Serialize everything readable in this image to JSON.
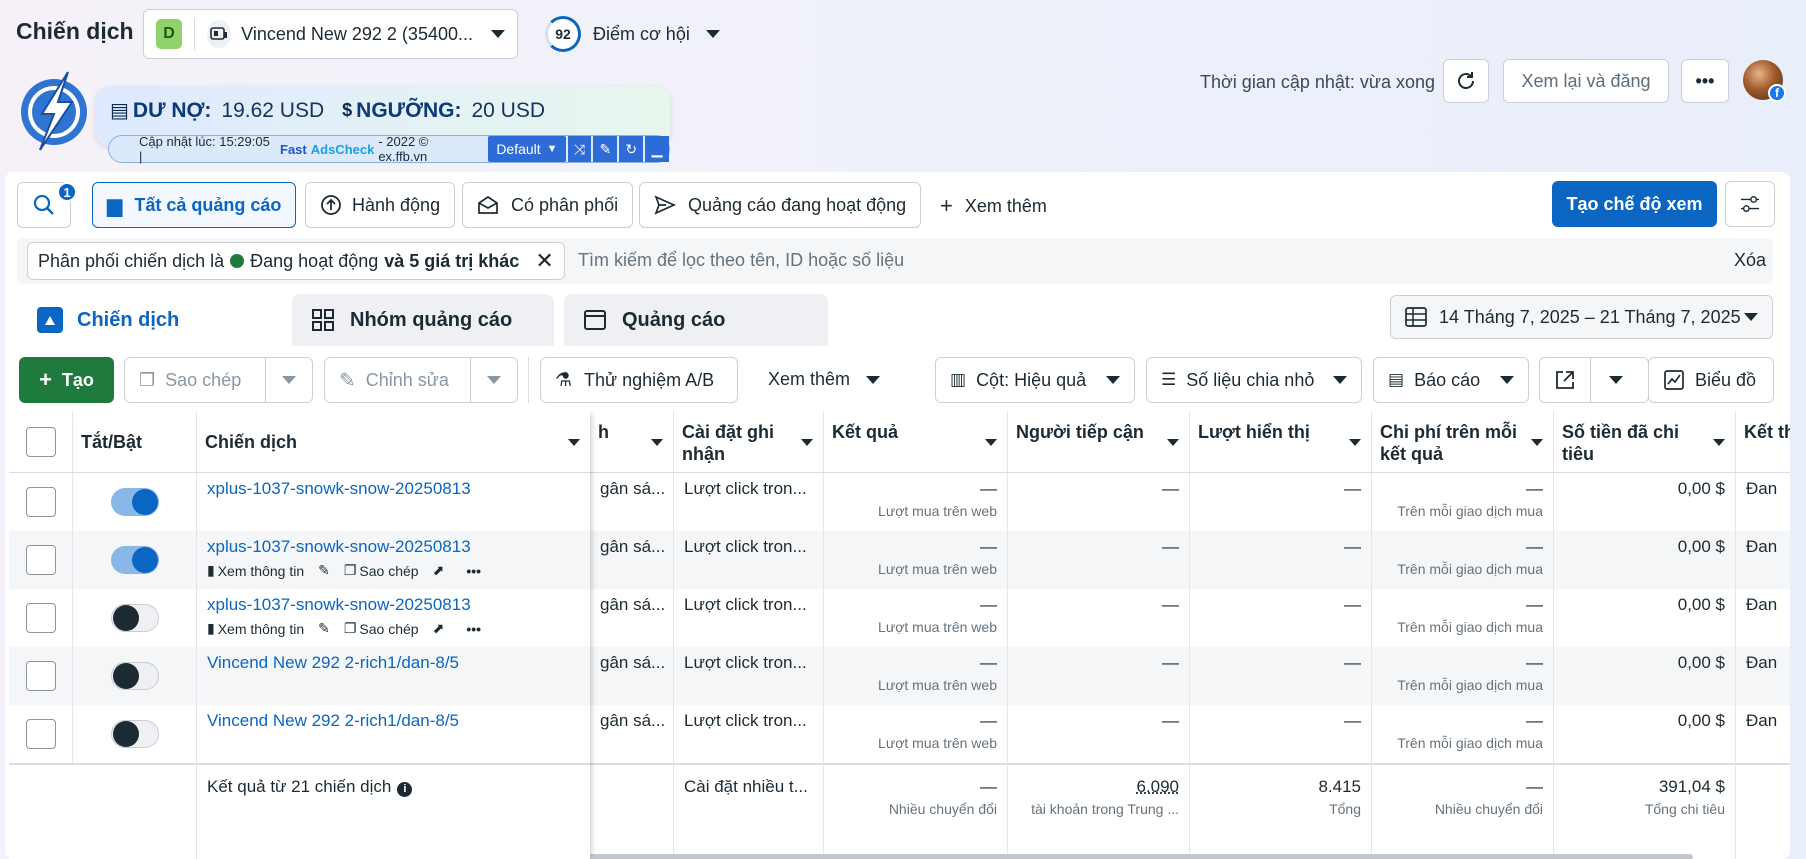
{
  "header": {
    "title": "Chiến dịch",
    "account_badge": "D",
    "account_name": "Vincend New 292 2 (35400...",
    "opportunity_score": "92",
    "opportunity_label": "Điểm cơ hội",
    "update_text": "Thời gian cập nhật: vừa xong",
    "review_button": "Xem lại và đăng",
    "more_button": "•••",
    "avatar_badge": "f"
  },
  "extension": {
    "debt_label": "DƯ NỢ:",
    "debt_value": "19.62 USD",
    "threshold_label": "NGƯỠNG:",
    "threshold_value": "20 USD",
    "status_prefix": "Cập nhật lúc: 15:29:05 |",
    "brand_fast": "Fast",
    "brand_adscheck": "AdsCheck",
    "status_suffix": "- 2022 © ex.ffb.vn",
    "profile_select": "Default"
  },
  "toolbar": {
    "search_badge": "1",
    "all_ads": "Tất cả quảng cáo",
    "actions": "Hành động",
    "delivery": "Có phân phối",
    "active_ads": "Quảng cáo đang hoạt động",
    "see_more": "Xem thêm",
    "create_view": "Tạo chế độ xem"
  },
  "filter": {
    "chip_prefix": "Phân phối chiến dịch là",
    "chip_status": "Đang hoạt động",
    "chip_more": "và 5 giá trị khác",
    "search_placeholder": "Tìm kiếm để lọc theo tên, ID hoặc số liệu",
    "clear": "Xóa"
  },
  "level_tabs": {
    "campaigns": "Chiến dịch",
    "adsets": "Nhóm quảng cáo",
    "ads": "Quảng cáo",
    "date_range": "14 Tháng 7, 2025 – 21 Tháng 7, 2025"
  },
  "actions": {
    "create": "Tạo",
    "duplicate": "Sao chép",
    "edit": "Chỉnh sửa",
    "ab_test": "Thử nghiệm A/B",
    "more": "Xem thêm",
    "columns": "Cột: Hiệu quả",
    "breakdown": "Số liệu chia nhỏ",
    "reports": "Báo cáo",
    "chart": "Biểu đồ"
  },
  "table": {
    "headers": {
      "toggle": "Tắt/Bật",
      "campaign": "Chiến dịch",
      "budget": "h",
      "attribution": "Cài đặt ghi nhận",
      "results": "Kết quả",
      "reach": "Người tiếp cận",
      "impressions": "Lượt hiển thị",
      "cost_per_result": "Chi phí trên mỗi kết quả",
      "amount_spent": "Số tiền đã chi tiêu",
      "ends": "Kết th"
    },
    "row_actions": {
      "view": "Xem thông tin",
      "duplicate": "Sao chép",
      "more": "•••"
    },
    "rows": [
      {
        "name": "xplus-1037-snowk-snow-20250813",
        "on": true,
        "actions": false,
        "budget": "gân sá...",
        "attribution": "Lượt click tron...",
        "results": "—",
        "results_sub": "Lượt mua trên web",
        "reach": "—",
        "impressions": "—",
        "cpr": "—",
        "cpr_sub": "Trên mỗi giao dịch mua",
        "spent": "0,00 $",
        "ends": "Đan"
      },
      {
        "name": "xplus-1037-snowk-snow-20250813",
        "on": true,
        "actions": true,
        "budget": "gân sá...",
        "attribution": "Lượt click tron...",
        "results": "—",
        "results_sub": "Lượt mua trên web",
        "reach": "—",
        "impressions": "—",
        "cpr": "—",
        "cpr_sub": "Trên mỗi giao dịch mua",
        "spent": "0,00 $",
        "ends": "Đan"
      },
      {
        "name": "xplus-1037-snowk-snow-20250813",
        "on": false,
        "actions": true,
        "budget": "gân sá...",
        "attribution": "Lượt click tron...",
        "results": "—",
        "results_sub": "Lượt mua trên web",
        "reach": "—",
        "impressions": "—",
        "cpr": "—",
        "cpr_sub": "Trên mỗi giao dịch mua",
        "spent": "0,00 $",
        "ends": "Đan"
      },
      {
        "name": "Vincend New 292 2-rich1/dan-8/5",
        "on": false,
        "actions": false,
        "budget": "gân sá...",
        "attribution": "Lượt click tron...",
        "results": "—",
        "results_sub": "Lượt mua trên web",
        "reach": "—",
        "impressions": "—",
        "cpr": "—",
        "cpr_sub": "Trên mỗi giao dịch mua",
        "spent": "0,00 $",
        "ends": "Đan"
      },
      {
        "name": "Vincend New 292 2-rich1/dan-8/5",
        "on": false,
        "actions": false,
        "budget": "gân sá...",
        "attribution": "Lượt click tron...",
        "results": "—",
        "results_sub": "Lượt mua trên web",
        "reach": "—",
        "impressions": "—",
        "cpr": "—",
        "cpr_sub": "Trên mỗi giao dịch mua",
        "spent": "0,00 $",
        "ends": "Đan"
      }
    ],
    "summary": {
      "label": "Kết quả từ 21 chiến dịch",
      "attribution": "Cài đặt nhiều t...",
      "results": "—",
      "results_sub": "Nhiều chuyển đổi",
      "reach": "6.090",
      "reach_sub": "tài khoản trong Trung ...",
      "impressions": "8.415",
      "impressions_sub": "Tổng",
      "cpr": "—",
      "cpr_sub": "Nhiều chuyển đổi",
      "spent": "391,04 $",
      "spent_sub": "Tổng chi tiêu"
    }
  }
}
